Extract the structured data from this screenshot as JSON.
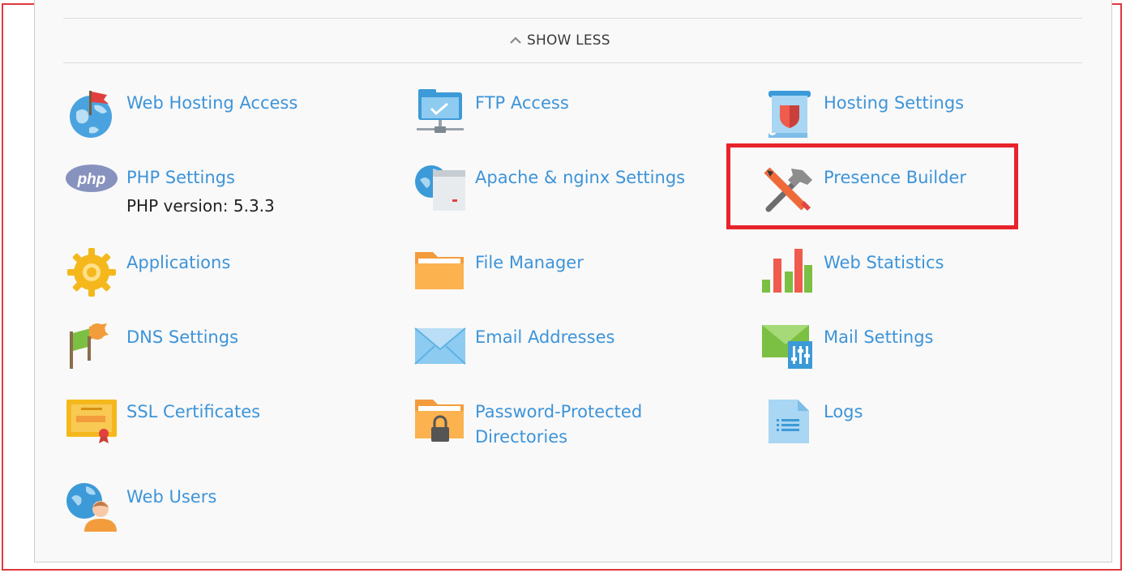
{
  "toggle": {
    "label": "SHOW LESS",
    "icon": "chevron-up-icon"
  },
  "items": [
    {
      "label": "Web Hosting Access",
      "icon": "globe-flag-icon"
    },
    {
      "label": "FTP Access",
      "icon": "ftp-folder-network-icon"
    },
    {
      "label": "Hosting Settings",
      "icon": "hosting-settings-scroll-shield-icon"
    },
    {
      "label": "PHP Settings",
      "sub": "PHP version: 5.3.3",
      "icon": "php-logo-icon"
    },
    {
      "label": "Apache & nginx Settings",
      "icon": "globe-server-icon"
    },
    {
      "label": "Presence Builder",
      "icon": "pencil-hammer-icon"
    },
    {
      "label": "Applications",
      "icon": "gear-icon"
    },
    {
      "label": "File Manager",
      "icon": "folder-icon"
    },
    {
      "label": "Web Statistics",
      "icon": "bar-chart-icon"
    },
    {
      "label": "DNS Settings",
      "icon": "dns-flags-icon"
    },
    {
      "label": "Email Addresses",
      "icon": "envelope-icon"
    },
    {
      "label": "Mail Settings",
      "icon": "mail-settings-envelope-sliders-icon"
    },
    {
      "label": "SSL Certificates",
      "icon": "certificate-icon"
    },
    {
      "label": "Password-Protected Directories",
      "icon": "locked-folder-icon"
    },
    {
      "label": "Logs",
      "icon": "log-document-icon"
    },
    {
      "label": "Web Users",
      "icon": "globe-user-icon"
    }
  ],
  "colors": {
    "link": "#3d94d9",
    "highlight_border": "#e8232b",
    "frame_border": "#e0383f",
    "panel_bg": "#f9f9f9"
  }
}
